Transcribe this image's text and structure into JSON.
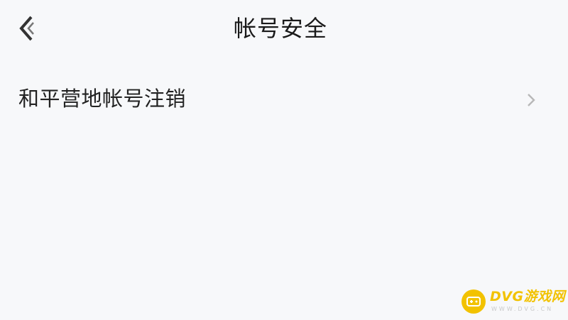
{
  "header": {
    "title": "帐号安全",
    "back_icon": "chevron-left-icon"
  },
  "settings": {
    "items": [
      {
        "label": "和平营地帐号注销",
        "icon": "chevron-right-icon"
      }
    ]
  },
  "watermark": {
    "brand": "DVG游戏网",
    "url": "WWW.DVG.CN",
    "color": "#f2c200"
  },
  "colors": {
    "background": "#f7f8fa",
    "text": "#1f1f1f",
    "chevron": "#b8b8b8"
  }
}
